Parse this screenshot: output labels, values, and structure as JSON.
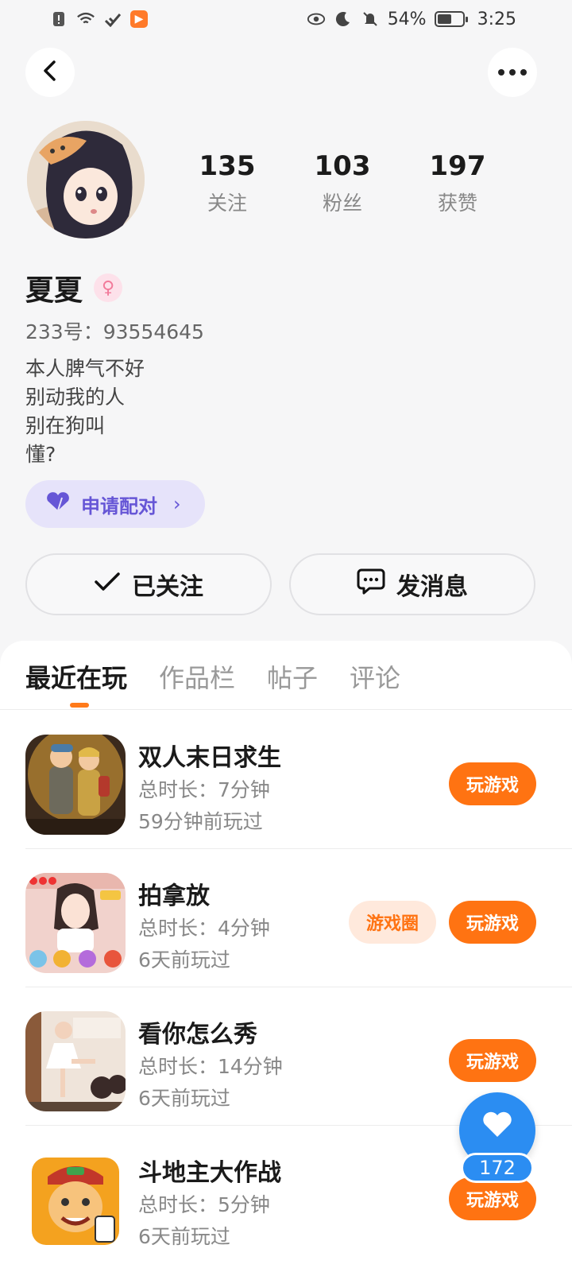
{
  "status_bar": {
    "battery": "54%",
    "time": "3:25",
    "icons": [
      "alert-icon",
      "wifi-icon",
      "link-icon",
      "app-icon",
      "eye-icon",
      "moon-icon",
      "mute-bell-icon",
      "battery-icon"
    ]
  },
  "profile": {
    "name": "夏夏",
    "gender_symbol": "♀",
    "uid": "233号：93554645",
    "bio": [
      "本人脾气不好",
      "别动我的人",
      "别在狗叫",
      "懂?"
    ],
    "stats": {
      "following": {
        "value": "135",
        "label": "关注"
      },
      "fans": {
        "value": "103",
        "label": "粉丝"
      },
      "likes": {
        "value": "197",
        "label": "获赞"
      }
    },
    "match_label": "申请配对",
    "follow_label": "已关注",
    "message_label": "发消息"
  },
  "tabs": [
    "最近在玩",
    "作品栏",
    "帖子",
    "评论"
  ],
  "games": [
    {
      "title": "双人末日求生",
      "duration": "总时长：7分钟",
      "last_played": "59分钟前玩过",
      "play_label": "玩游戏"
    },
    {
      "title": "拍拿放",
      "duration": "总时长：4分钟",
      "last_played": "6天前玩过",
      "play_label": "玩游戏",
      "circle_label": "游戏圈"
    },
    {
      "title": "看你怎么秀",
      "duration": "总时长：14分钟",
      "last_played": "6天前玩过",
      "play_label": "玩游戏"
    },
    {
      "title": "斗地主大作战",
      "duration": "总时长：5分钟",
      "last_played": "6天前玩过",
      "play_label": "玩游戏"
    }
  ],
  "like_fab": {
    "count": "172"
  },
  "colors": {
    "accent": "#ff7312",
    "match": "#6656d6",
    "fab": "#2b8df2"
  }
}
